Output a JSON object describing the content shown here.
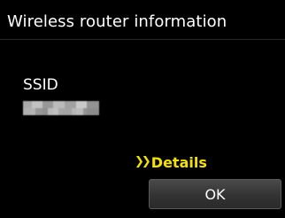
{
  "header": {
    "title": "Wireless router information"
  },
  "ssid": {
    "label": "SSID",
    "value_masked": true
  },
  "details_link": {
    "icon": "double-chevron-right-icon",
    "label": "Details",
    "color": "#f3e200"
  },
  "ok_button": {
    "label": "OK"
  },
  "colors": {
    "background": "#000000",
    "text": "#ffffff",
    "accent": "#f3e200"
  }
}
